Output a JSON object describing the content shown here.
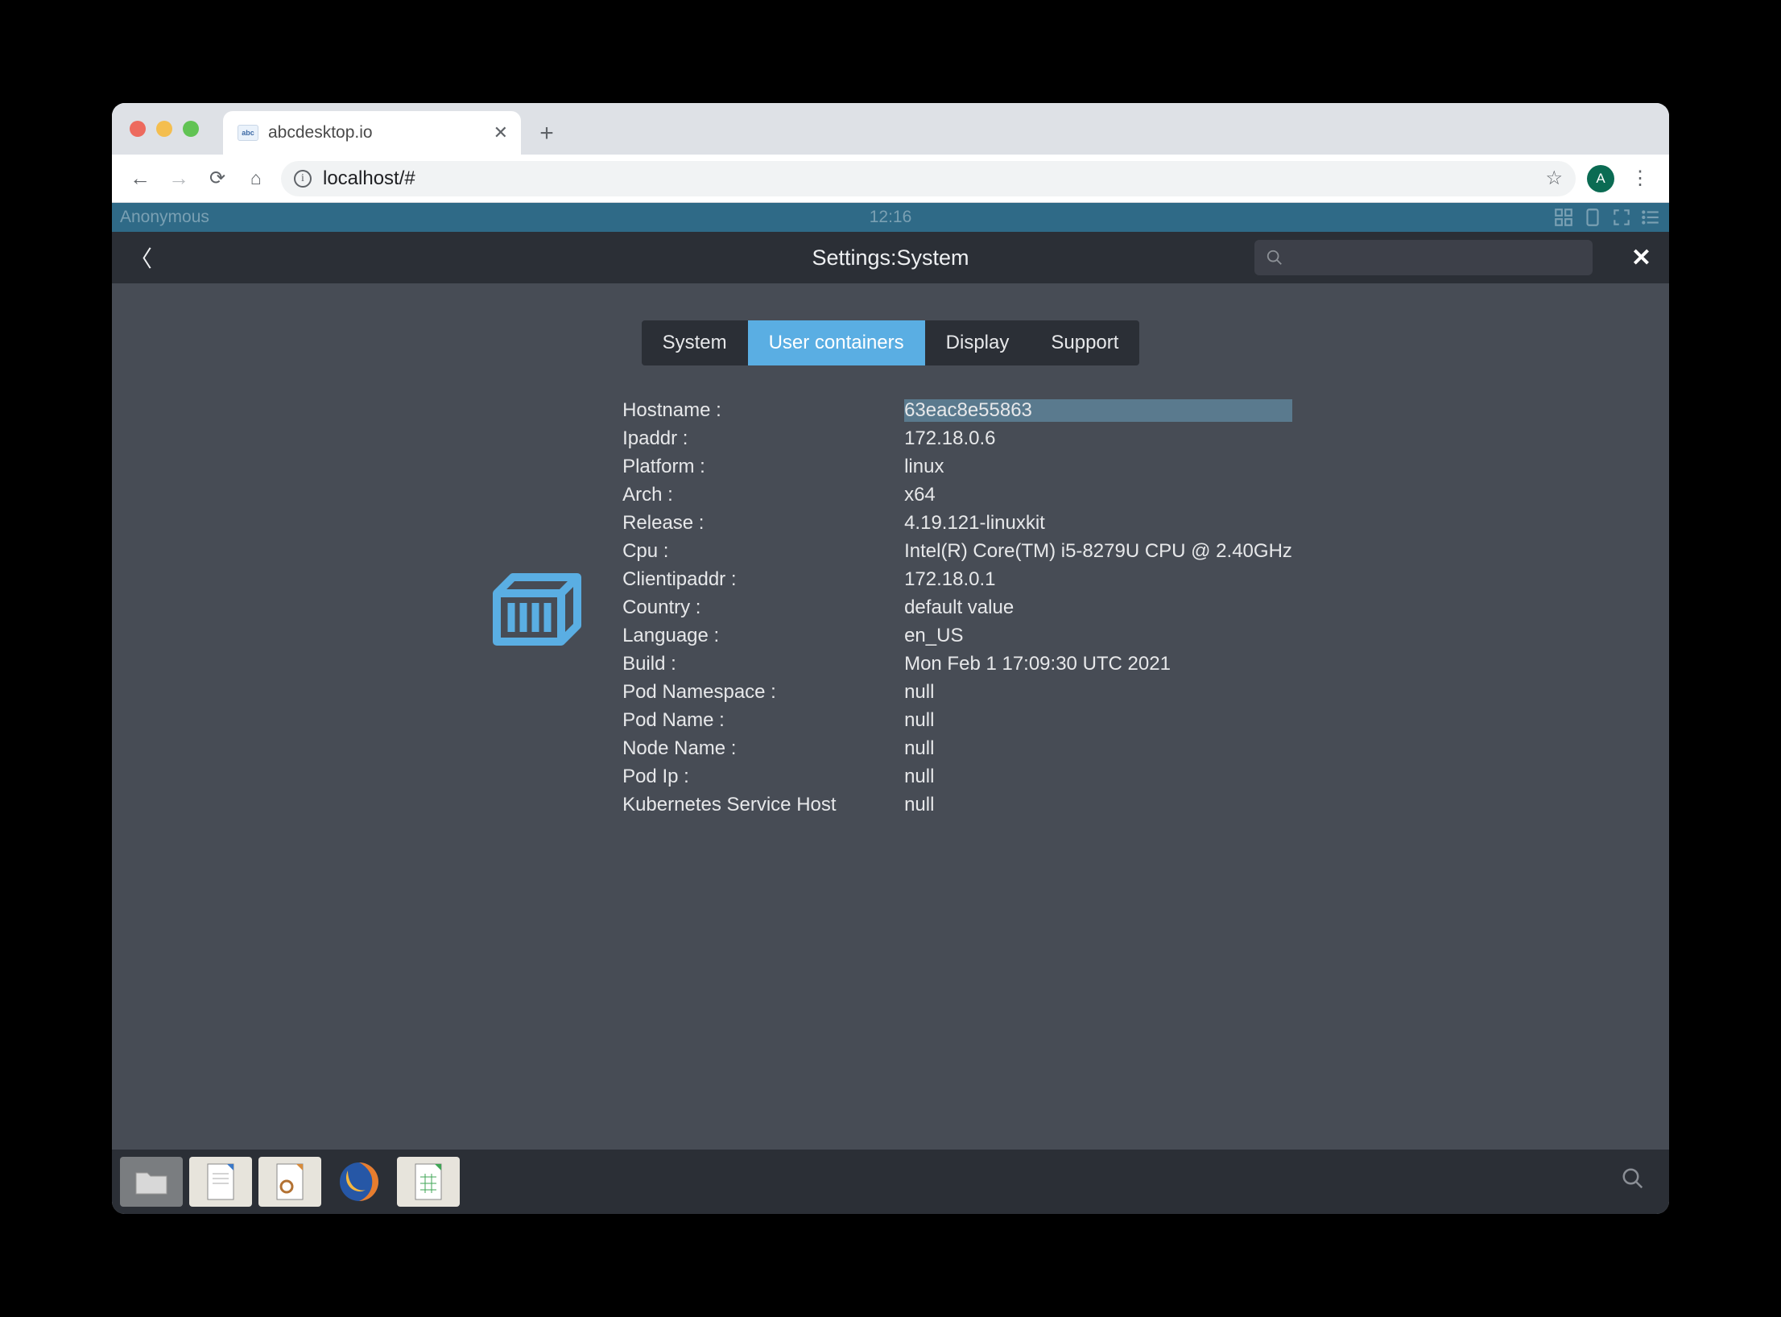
{
  "browser": {
    "tab_title": "abcdesktop.io",
    "favicon_text": "abc",
    "url": "localhost/#",
    "avatar_initial": "A"
  },
  "app_topbar": {
    "user": "Anonymous",
    "clock": "12:16"
  },
  "settings_bar": {
    "title": "Settings:System"
  },
  "tabs": {
    "system": "System",
    "user_containers": "User containers",
    "display": "Display",
    "support": "Support"
  },
  "system_info": {
    "rows": [
      {
        "label": "Hostname :",
        "value": "63eac8e55863",
        "highlight": true
      },
      {
        "label": "Ipaddr :",
        "value": "172.18.0.6"
      },
      {
        "label": "Platform :",
        "value": "linux"
      },
      {
        "label": "Arch :",
        "value": "x64"
      },
      {
        "label": "Release :",
        "value": "4.19.121-linuxkit"
      },
      {
        "label": "Cpu :",
        "value": "Intel(R) Core(TM) i5-8279U CPU @ 2.40GHz"
      },
      {
        "label": "Clientipaddr :",
        "value": "172.18.0.1"
      },
      {
        "label": "Country :",
        "value": "default value"
      },
      {
        "label": "Language :",
        "value": "en_US"
      },
      {
        "label": "Build :",
        "value": "Mon Feb 1 17:09:30 UTC 2021"
      },
      {
        "label": "Pod Namespace :",
        "value": "null"
      },
      {
        "label": "Pod Name :",
        "value": "null"
      },
      {
        "label": "Node Name :",
        "value": "null"
      },
      {
        "label": "Pod Ip :",
        "value": "null"
      },
      {
        "label": "Kubernetes Service Host",
        "value": "null"
      }
    ]
  }
}
